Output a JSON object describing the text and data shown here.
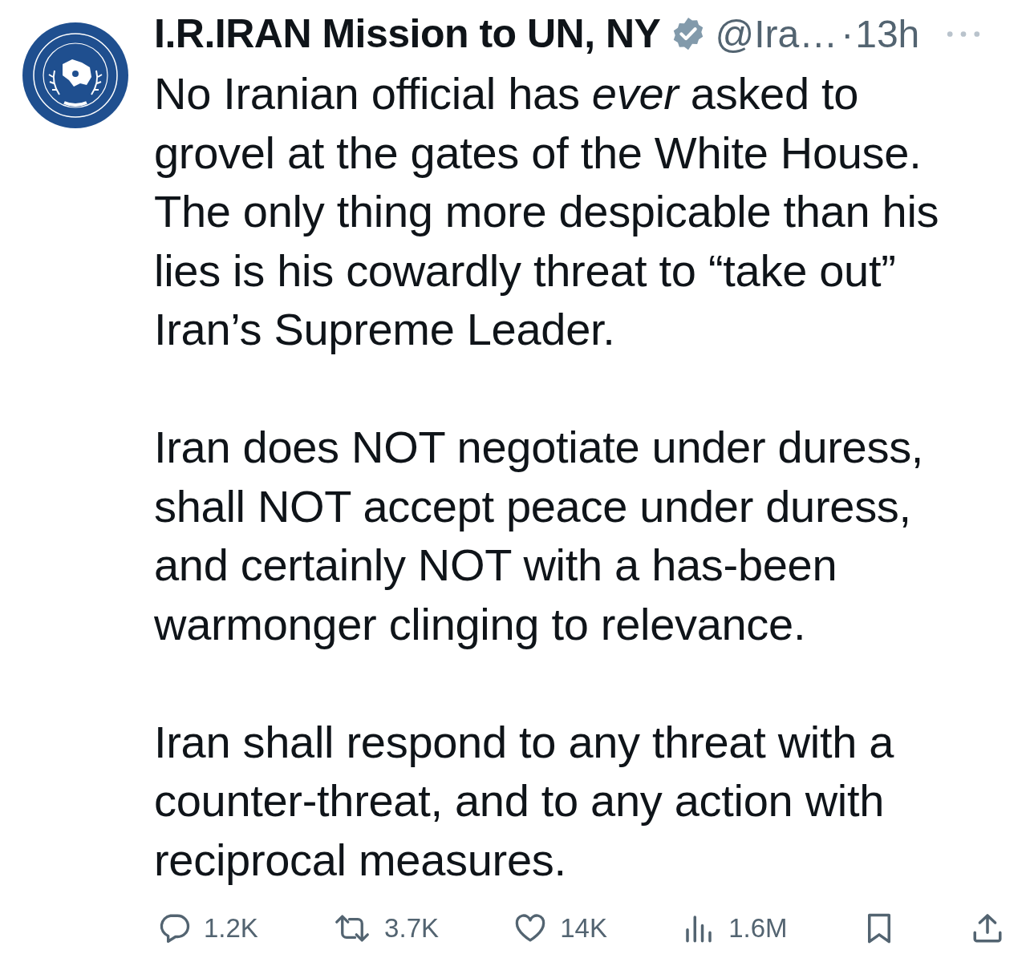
{
  "author": {
    "name": "I.R.IRAN Mission to UN, NY",
    "verified": true,
    "handle": "@Ira…",
    "separator": "·",
    "time": "13h"
  },
  "paragraphs": [
    [
      "No Iranian official has *ever* asked to",
      "grovel at the gates of the White House.",
      "The only thing more despicable than his",
      "lies is his cowardly threat to “take out”",
      "Iran’s Supreme Leader."
    ],
    [
      "Iran does NOT negotiate under duress,",
      "shall NOT accept peace under duress,",
      "and certainly NOT with a has-been",
      "warmonger clinging to relevance."
    ],
    [
      "Iran shall respond to any threat with a",
      "counter-threat, and to any action with",
      "reciprocal measures."
    ]
  ],
  "actions": [
    {
      "kind": "reply",
      "count": "1.2K"
    },
    {
      "kind": "repost",
      "count": "3.7K"
    },
    {
      "kind": "like",
      "count": "14K"
    },
    {
      "kind": "views",
      "count": "1.6M"
    },
    {
      "kind": "bookmark"
    },
    {
      "kind": "share"
    }
  ]
}
